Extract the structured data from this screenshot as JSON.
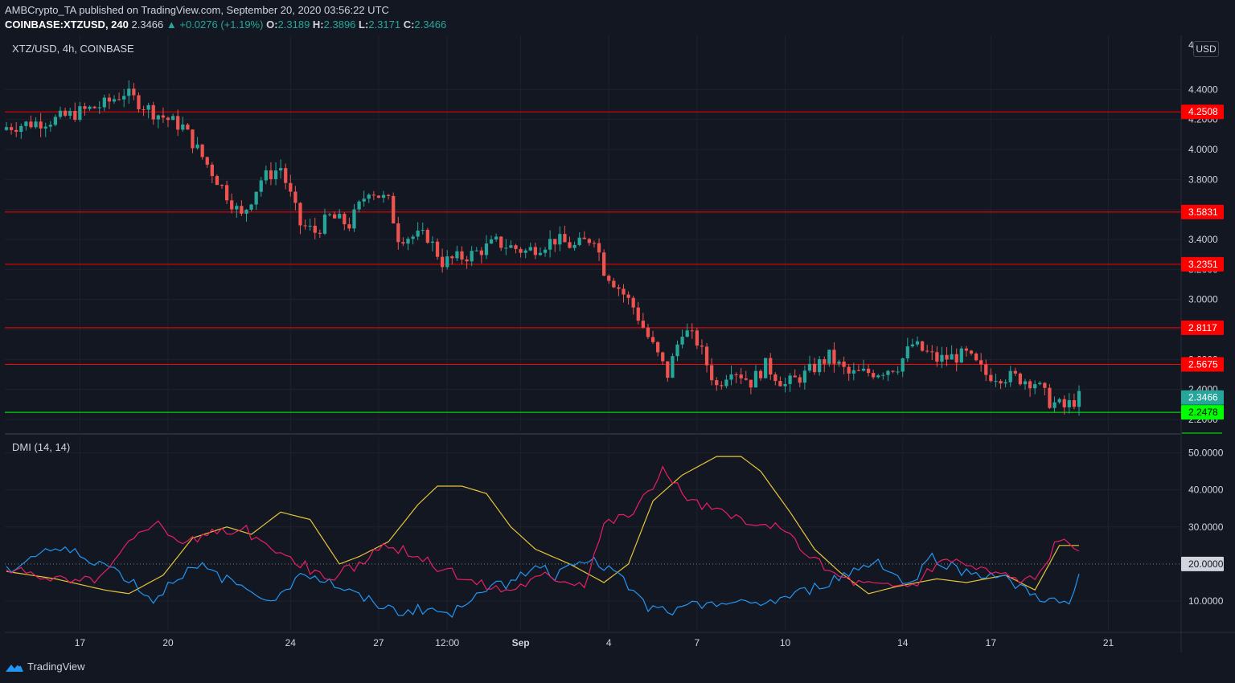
{
  "header": {
    "publisher_line": "AMBCrypto_TA published on TradingView.com, September 20, 2020 03:56:22 UTC",
    "symbol": "COINBASE:XTZUSD, 240",
    "last": "2.3466",
    "change": "▲ +0.0276 (+1.19%)",
    "o_label": "O:",
    "o_val": "2.3189",
    "h_label": "H:",
    "h_val": "2.3896",
    "l_label": "L:",
    "l_val": "2.3171",
    "c_label": "C:",
    "c_val": "2.3466"
  },
  "pane_title": "XTZ/USD, 4h, COINBASE",
  "dmi_title": "DMI (14, 14)",
  "currency": "USD",
  "price_axis_top": "4",
  "footer_brand": "TradingView",
  "colors": {
    "bg": "#131722",
    "up": "#26a69a",
    "down": "#ef5350",
    "resistance": "#ff0000",
    "support": "#00ff00",
    "adx": "#e6c53a",
    "plus_di": "#2196f3",
    "minus_di": "#e91e63"
  },
  "chart_data": [
    {
      "type": "candlestick",
      "title": "XTZ/USD, 4h, COINBASE",
      "ylim": [
        2.12,
        4.6
      ],
      "y_ticks": [
        "4.4000",
        "4.2000",
        "4.0000",
        "3.8000",
        "3.6000",
        "3.4000",
        "3.2000",
        "3.0000",
        "2.8000",
        "2.6000",
        "2.4000",
        "2.2000"
      ],
      "x_ticks": [
        "17",
        "20",
        "24",
        "27",
        "12:00",
        "Sep",
        "4",
        "7",
        "10",
        "14",
        "17",
        "21"
      ],
      "last_price": "2.3466",
      "horizontal_levels": [
        {
          "label": "4.2508",
          "value": 4.2508,
          "kind": "resistance"
        },
        {
          "label": "3.5831",
          "value": 3.5831,
          "kind": "resistance"
        },
        {
          "label": "3.2351",
          "value": 3.2351,
          "kind": "resistance"
        },
        {
          "label": "2.8117",
          "value": 2.8117,
          "kind": "resistance"
        },
        {
          "label": "2.5675",
          "value": 2.5675,
          "kind": "resistance"
        },
        {
          "label": "2.2478",
          "value": 2.2478,
          "kind": "support"
        }
      ],
      "close_path": [
        [
          0,
          4.15
        ],
        [
          10,
          4.2
        ],
        [
          20,
          4.3
        ],
        [
          24,
          4.38
        ],
        [
          30,
          4.25
        ],
        [
          36,
          4.15
        ],
        [
          40,
          3.95
        ],
        [
          44,
          3.75
        ],
        [
          48,
          3.55
        ],
        [
          52,
          3.8
        ],
        [
          56,
          3.88
        ],
        [
          60,
          3.5
        ],
        [
          63,
          3.45
        ],
        [
          66,
          3.55
        ],
        [
          70,
          3.5
        ],
        [
          74,
          3.74
        ],
        [
          78,
          3.65
        ],
        [
          80,
          3.42
        ],
        [
          86,
          3.42
        ],
        [
          89,
          3.25
        ],
        [
          95,
          3.3
        ],
        [
          100,
          3.38
        ],
        [
          106,
          3.32
        ],
        [
          112,
          3.4
        ],
        [
          116,
          3.35
        ],
        [
          120,
          3.42
        ],
        [
          122,
          3.2
        ],
        [
          125,
          3.08
        ],
        [
          128,
          2.95
        ],
        [
          131,
          2.75
        ],
        [
          135,
          2.5
        ],
        [
          138,
          2.8
        ],
        [
          141,
          2.72
        ],
        [
          145,
          2.42
        ],
        [
          148,
          2.55
        ],
        [
          152,
          2.45
        ],
        [
          155,
          2.56
        ],
        [
          159,
          2.43
        ],
        [
          163,
          2.5
        ],
        [
          168,
          2.62
        ],
        [
          172,
          2.5
        ],
        [
          178,
          2.52
        ],
        [
          182,
          2.56
        ],
        [
          185,
          2.7
        ],
        [
          190,
          2.6
        ],
        [
          196,
          2.63
        ],
        [
          200,
          2.5
        ],
        [
          206,
          2.48
        ],
        [
          210,
          2.45
        ],
        [
          213,
          2.32
        ],
        [
          216,
          2.28
        ],
        [
          219,
          2.3466
        ]
      ]
    },
    {
      "type": "line",
      "title": "DMI (14, 14)",
      "ylim": [
        2,
        54
      ],
      "y_ticks": [
        "50.0000",
        "40.0000",
        "30.0000",
        "10.0000"
      ],
      "reference_level": {
        "label": "20.0000",
        "value": 20
      },
      "series": [
        {
          "key": "adx",
          "points": [
            [
              0,
              18
            ],
            [
              10,
              16
            ],
            [
              20,
              13
            ],
            [
              25,
              12
            ],
            [
              32,
              17
            ],
            [
              38,
              27
            ],
            [
              45,
              30
            ],
            [
              50,
              28
            ],
            [
              56,
              34
            ],
            [
              62,
              32
            ],
            [
              68,
              20
            ],
            [
              72,
              22
            ],
            [
              78,
              26
            ],
            [
              84,
              36
            ],
            [
              88,
              41
            ],
            [
              93,
              41
            ],
            [
              98,
              39
            ],
            [
              103,
              30
            ],
            [
              108,
              24
            ],
            [
              115,
              20
            ],
            [
              122,
              15
            ],
            [
              127,
              20
            ],
            [
              132,
              37
            ],
            [
              138,
              44
            ],
            [
              145,
              49
            ],
            [
              150,
              49
            ],
            [
              154,
              45
            ],
            [
              160,
              34
            ],
            [
              165,
              24
            ],
            [
              170,
              18
            ],
            [
              176,
              12
            ],
            [
              182,
              14
            ],
            [
              190,
              16
            ],
            [
              196,
              15
            ],
            [
              204,
              17
            ],
            [
              210,
              13
            ],
            [
              215,
              25
            ],
            [
              219,
              25
            ]
          ]
        },
        {
          "key": "plus_di",
          "points": [
            [
              0,
              18
            ],
            [
              8,
              24
            ],
            [
              14,
              23
            ],
            [
              20,
              20
            ],
            [
              25,
              16
            ],
            [
              30,
              10
            ],
            [
              35,
              17
            ],
            [
              40,
              19
            ],
            [
              46,
              15
            ],
            [
              52,
              12
            ],
            [
              56,
              11
            ],
            [
              60,
              18
            ],
            [
              66,
              15
            ],
            [
              72,
              11
            ],
            [
              80,
              7
            ],
            [
              86,
              8
            ],
            [
              91,
              6
            ],
            [
              96,
              13
            ],
            [
              103,
              15
            ],
            [
              108,
              20
            ],
            [
              112,
              17
            ],
            [
              117,
              22
            ],
            [
              124,
              18
            ],
            [
              131,
              8
            ],
            [
              137,
              7
            ],
            [
              143,
              10
            ],
            [
              150,
              9
            ],
            [
              157,
              10
            ],
            [
              164,
              13
            ],
            [
              171,
              17
            ],
            [
              178,
              21
            ],
            [
              184,
              14
            ],
            [
              189,
              22
            ],
            [
              195,
              18
            ],
            [
              202,
              17
            ],
            [
              208,
              13
            ],
            [
              213,
              10
            ],
            [
              217,
              9
            ],
            [
              219,
              16
            ]
          ]
        },
        {
          "key": "minus_di",
          "points": [
            [
              0,
              18
            ],
            [
              8,
              17
            ],
            [
              14,
              15
            ],
            [
              20,
              17
            ],
            [
              24,
              24
            ],
            [
              30,
              32
            ],
            [
              36,
              26
            ],
            [
              42,
              28
            ],
            [
              48,
              30
            ],
            [
              54,
              24
            ],
            [
              60,
              20
            ],
            [
              66,
              16
            ],
            [
              72,
              20
            ],
            [
              78,
              25
            ],
            [
              84,
              22
            ],
            [
              90,
              18
            ],
            [
              96,
              15
            ],
            [
              102,
              13
            ],
            [
              110,
              17
            ],
            [
              118,
              15
            ],
            [
              122,
              31
            ],
            [
              128,
              34
            ],
            [
              134,
              45
            ],
            [
              140,
              37
            ],
            [
              146,
              34
            ],
            [
              152,
              30
            ],
            [
              156,
              31
            ],
            [
              162,
              25
            ],
            [
              168,
              18
            ],
            [
              174,
              15
            ],
            [
              180,
              14
            ],
            [
              186,
              15
            ],
            [
              192,
              22
            ],
            [
              198,
              19
            ],
            [
              204,
              17
            ],
            [
              210,
              15
            ],
            [
              215,
              27
            ],
            [
              219,
              22
            ]
          ]
        }
      ]
    }
  ]
}
